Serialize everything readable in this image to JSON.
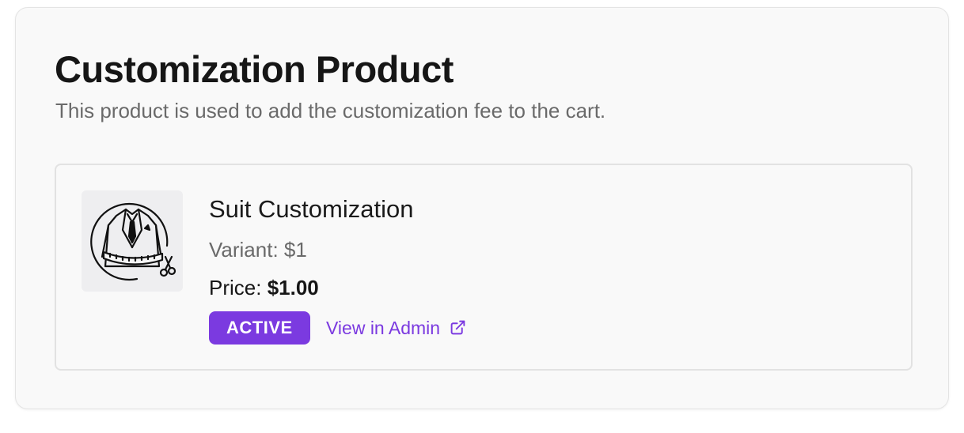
{
  "section": {
    "title": "Customization Product",
    "subtitle": "This product is used to add the customization fee to the cart."
  },
  "product": {
    "image_icon": "suit-tailoring-icon",
    "name": "Suit Customization",
    "variant_label": "Variant: $1",
    "price_label": "Price:",
    "price_value": "$1.00",
    "status": "ACTIVE",
    "admin_link_label": "View in Admin",
    "admin_link_icon": "external-link-icon"
  },
  "colors": {
    "accent": "#7b3ae0",
    "card_background": "#f9f9f9",
    "text_muted": "#6a6a6a"
  }
}
